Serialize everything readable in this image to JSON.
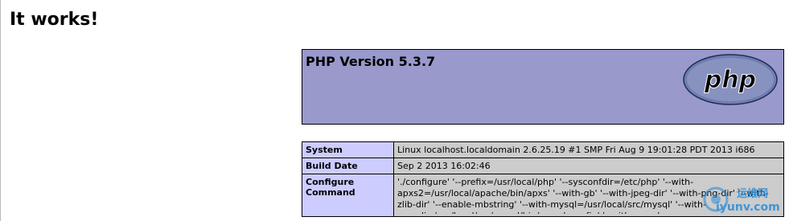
{
  "page": {
    "title": "It works!"
  },
  "phpinfo": {
    "version_title": "PHP Version 5.3.7",
    "logo_text": "php",
    "rows": [
      {
        "key": "System",
        "value": "Linux localhost.localdomain 2.6.25.19 #1 SMP Fri Aug 9 19:01:28 PDT 2013 i686"
      },
      {
        "key": "Build Date",
        "value": "Sep 2 2013 16:02:46"
      },
      {
        "key": "Configure Command",
        "value": "'./configure' '--prefix=/usr/local/php' '--sysconfdir=/etc/php' '--with-apxs2=/usr/local/apache/bin/apxs' '--with-gb' '--with-jpeg-dir' '--with-png-dir' '--with-zlib-dir' '--enable-mbstring' '--with-mysql=/usr/local/src/mysql' '--with-mysqli=/usr/local/src/mysql/bin/mysql_config' '--with-mysql-sock=/usr/local/src/mysql/bin/mysql_config'"
      }
    ]
  },
  "watermark": {
    "chinese": "运维网",
    "url": "iyunv.com"
  },
  "colors": {
    "header_bg": "#9999cc",
    "key_bg": "#ccccff",
    "value_bg": "#cccccc"
  }
}
